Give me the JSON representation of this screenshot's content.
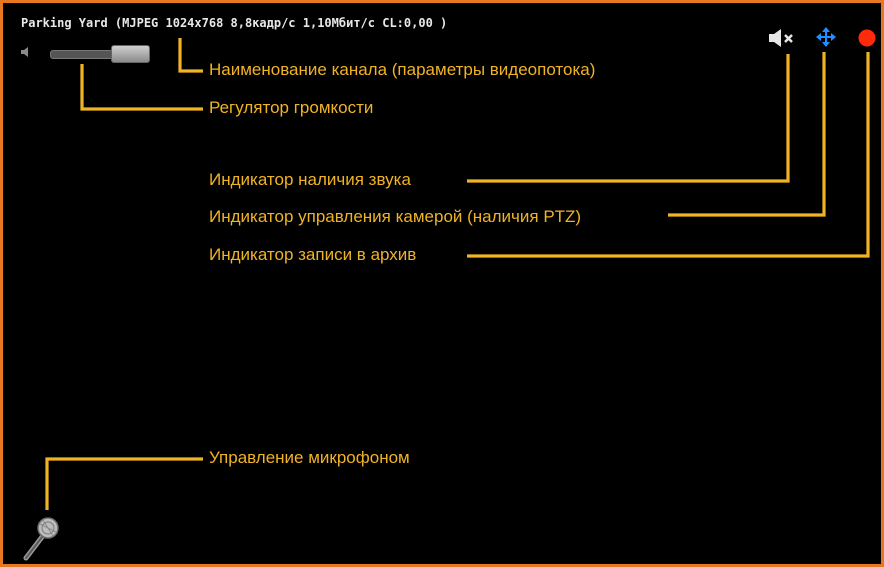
{
  "channel": {
    "title": "Parking Yard (MJPEG 1024x768 8,8кадр/с 1,10Мбит/с CL:0,00 )"
  },
  "icons": {
    "volume": "speaker-icon",
    "sound_indicator": "speaker-muted-icon",
    "ptz_indicator": "four-arrows-move-icon",
    "record_indicator": "red-dot-icon",
    "microphone": "microphone-icon"
  },
  "annotations": {
    "channel_name": "Наименование канала (параметры видеопотока)",
    "volume_control": "Регулятор громкости",
    "sound_indicator": "Индикатор наличия звука",
    "ptz_indicator": "Индикатор управления камерой (наличия PTZ)",
    "record_indicator": "Индикатор записи в архив",
    "microphone_control": "Управление микрофоном"
  },
  "colors": {
    "frame_border": "#e87722",
    "annotation": "#f0b324",
    "ptz_blue": "#1e90ff",
    "record_red": "#ff2a0a"
  }
}
